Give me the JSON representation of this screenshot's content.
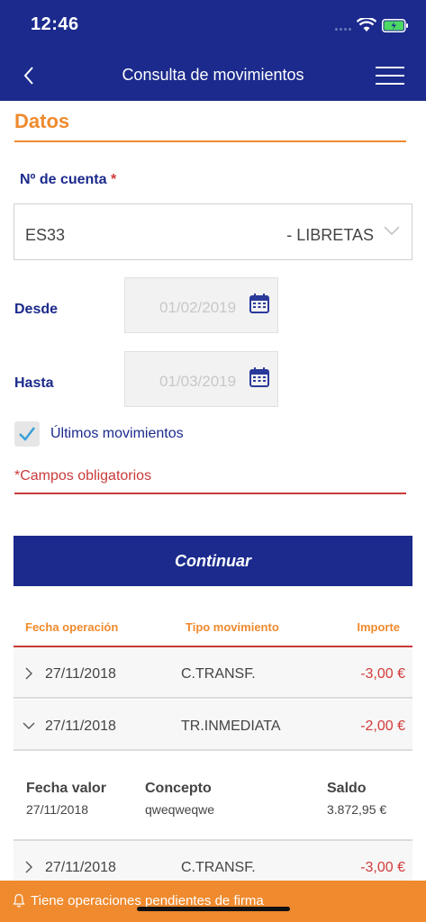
{
  "status_bar": {
    "time": "12:46"
  },
  "nav": {
    "title": "Consulta de movimientos"
  },
  "section": {
    "title": "Datos"
  },
  "form": {
    "account_label": "Nº de cuenta",
    "required_mark": "*",
    "account_prefix": "ES33",
    "account_type": "- LIBRETAS",
    "from_label": "Desde",
    "from_value": "01/02/2019",
    "to_label": "Hasta",
    "to_value": "01/03/2019",
    "last_movements_label": "Últimos movimientos",
    "last_movements_checked": true,
    "required_note": "*Campos obligatorios",
    "continue_label": "Continuar"
  },
  "table": {
    "headers": [
      "Fecha operación",
      "Tipo movimiento",
      "Importe"
    ],
    "rows": [
      {
        "date": "27/11/2018",
        "type": "C.TRANSF.",
        "amount": "-3,00 €",
        "expanded": false
      },
      {
        "date": "27/11/2018",
        "type": "TR.INMEDIATA",
        "amount": "-2,00 €",
        "expanded": true
      },
      {
        "date": "27/11/2018",
        "type": "C.TRANSF.",
        "amount": "-3,00 €",
        "expanded": false
      }
    ],
    "detail": {
      "value_date_label": "Fecha valor",
      "value_date": "27/11/2018",
      "concept_label": "Concepto",
      "concept": "qweqweqwe",
      "balance_label": "Saldo",
      "balance": "3.872,95 €"
    }
  },
  "pending": {
    "text": "Tiene operaciones pendientes de firma"
  },
  "colors": {
    "primary": "#1b2a8c",
    "accent": "#ef8a2e",
    "negative": "#d33a3a"
  }
}
